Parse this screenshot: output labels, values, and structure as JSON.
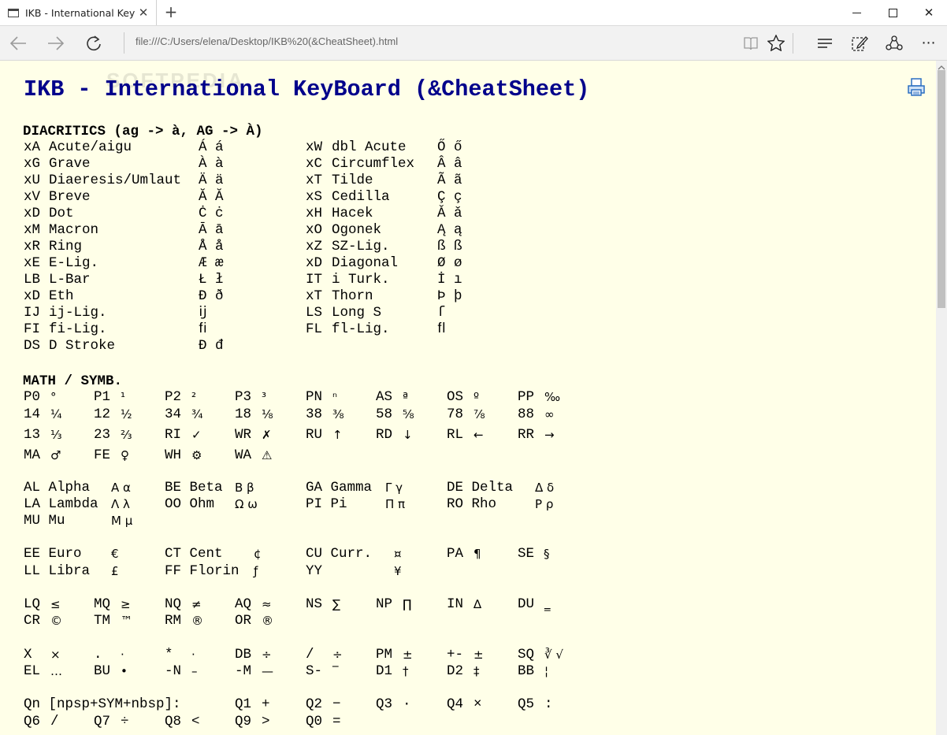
{
  "browser": {
    "tab_title": "IKB - International KeyBo",
    "address": "file:///C:/Users/elena/Desktop/IKB%20(&CheatSheet).html"
  },
  "watermark": "SOFTPEDIA",
  "page": {
    "title": "IKB - International KeyBoard (&CheatSheet)",
    "diacritics": {
      "heading": "DIACRITICS (ag -> à, AG -> À)",
      "left": [
        {
          "code": "xA",
          "name": "Acute/aigu",
          "chars": "Á á"
        },
        {
          "code": "xG",
          "name": "Grave",
          "chars": "À à"
        },
        {
          "code": "xU",
          "name": "Diaeresis/Umlaut",
          "chars": "Ä ä"
        },
        {
          "code": "xV",
          "name": "Breve",
          "chars": "Ă Ă"
        },
        {
          "code": "xD",
          "name": "Dot",
          "chars": "Ċ ċ"
        },
        {
          "code": "xM",
          "name": "Macron",
          "chars": "Ā ā"
        },
        {
          "code": "xR",
          "name": "Ring",
          "chars": "Å å"
        },
        {
          "code": "xE",
          "name": "E-Lig.",
          "chars": "Æ æ"
        },
        {
          "code": "LB",
          "name": "L-Bar",
          "chars": "Ł ł"
        },
        {
          "code": "xD",
          "name": "Eth",
          "chars": "Ð ð"
        },
        {
          "code": "IJ",
          "name": "ij-Lig.",
          "chars": "ĳ"
        },
        {
          "code": "FI",
          "name": "fi-Lig.",
          "chars": "ﬁ"
        },
        {
          "code": "DS",
          "name": "D Stroke",
          "chars": "Đ đ"
        }
      ],
      "right": [
        {
          "code": "xW",
          "name": "dbl Acute",
          "chars": "Ő ő"
        },
        {
          "code": "xC",
          "name": "Circumflex",
          "chars": "Â â"
        },
        {
          "code": "xT",
          "name": "Tilde",
          "chars": "Ã ã"
        },
        {
          "code": "xS",
          "name": "Cedilla",
          "chars": "Ç ç"
        },
        {
          "code": "xH",
          "name": "Hacek",
          "chars": "Ǎ ǎ"
        },
        {
          "code": "xO",
          "name": "Ogonek",
          "chars": "Ą ą"
        },
        {
          "code": "xZ",
          "name": "SZ-Lig.",
          "chars": "ß ß"
        },
        {
          "code": "xD",
          "name": "Diagonal",
          "chars": "Ø ø"
        },
        {
          "code": "IT",
          "name": "i Turk.",
          "chars": "İ ı"
        },
        {
          "code": "xT",
          "name": "Thorn",
          "chars": "Þ þ"
        },
        {
          "code": "LS",
          "name": "Long S",
          "chars": "ſ"
        },
        {
          "code": "FL",
          "name": "fl-Lig.",
          "chars": "ﬂ"
        }
      ]
    },
    "math": {
      "heading": "MATH / SYMB.",
      "rows": [
        [
          [
            "P0",
            "°"
          ],
          [
            "P1",
            "¹"
          ],
          [
            "P2",
            "²"
          ],
          [
            "P3",
            "³"
          ],
          [
            "PN",
            "ⁿ"
          ],
          [
            "AS",
            "ª"
          ],
          [
            "OS",
            "º"
          ],
          [
            "PP",
            "‰"
          ]
        ],
        [
          [
            "14",
            "¼"
          ],
          [
            "12",
            "½"
          ],
          [
            "34",
            "¾"
          ],
          [
            "18",
            "⅛"
          ],
          [
            "38",
            "⅜"
          ],
          [
            "58",
            "⅝"
          ],
          [
            "78",
            "⅞"
          ],
          [
            "88",
            "∞"
          ]
        ],
        [
          [
            "13",
            "⅓"
          ],
          [
            "23",
            "⅔"
          ],
          [
            "RI",
            "✓"
          ],
          [
            "WR",
            "✗"
          ],
          [
            "RU",
            "↑"
          ],
          [
            "RD",
            "↓"
          ],
          [
            "RL",
            "←"
          ],
          [
            "RR",
            "→"
          ]
        ],
        [
          [
            "MA",
            "♂"
          ],
          [
            "FE",
            "♀"
          ],
          [
            "WH",
            "⚙"
          ],
          [
            "WA",
            "⚠"
          ]
        ]
      ]
    },
    "greek": [
      [
        [
          "AL Alpha",
          "Α α"
        ],
        [
          "BE Beta",
          "Β β"
        ],
        [
          "GA Gamma",
          "Γ γ"
        ],
        [
          "DE Delta",
          "Δ δ"
        ]
      ],
      [
        [
          "LA Lambda",
          "Λ λ"
        ],
        [
          "OO Ohm",
          "Ω ω"
        ],
        [
          "PI Pi",
          "Π π"
        ],
        [
          "RO Rho",
          "Ρ ρ"
        ]
      ],
      [
        [
          "MU Mu",
          "Μ μ"
        ]
      ]
    ],
    "currency": [
      [
        [
          "EE Euro",
          "€"
        ],
        [
          "CT Cent",
          "¢"
        ],
        [
          "CU Curr.",
          "¤"
        ],
        [
          "PA",
          "¶"
        ],
        [
          "SE",
          "§"
        ]
      ],
      [
        [
          "LL Libra",
          "£"
        ],
        [
          "FF Florin",
          "ƒ"
        ],
        [
          "YY",
          "¥"
        ]
      ]
    ],
    "relations": [
      [
        [
          "LQ",
          "≤"
        ],
        [
          "MQ",
          "≥"
        ],
        [
          "NQ",
          "≠"
        ],
        [
          "AQ",
          "≈"
        ],
        [
          "NS",
          "∑"
        ],
        [
          "NP",
          "∏"
        ],
        [
          "IN",
          "∆"
        ],
        [
          "DU",
          "‗"
        ]
      ],
      [
        [
          "CR",
          "©"
        ],
        [
          "TM",
          "™"
        ],
        [
          "RM",
          "®"
        ],
        [
          "OR",
          "®"
        ]
      ]
    ],
    "operators": [
      [
        [
          "X",
          "×"
        ],
        [
          ".",
          "·"
        ],
        [
          "*",
          "·"
        ],
        [
          "DB",
          "÷"
        ],
        [
          "/",
          "÷"
        ],
        [
          "PM",
          "±"
        ],
        [
          "+-",
          "±"
        ],
        [
          "SQ",
          "∛ √"
        ]
      ],
      [
        [
          "EL",
          "…"
        ],
        [
          "BU",
          "•"
        ],
        [
          "-N",
          "–"
        ],
        [
          "-M",
          "—"
        ],
        [
          "S-",
          "‾"
        ],
        [
          "D1",
          "†"
        ],
        [
          "D2",
          "‡"
        ],
        [
          "BB",
          "¦"
        ]
      ]
    ],
    "quick": {
      "intro": "Qn [npsp+SYM+nbsp]:",
      "row1": [
        [
          "Q1",
          "+"
        ],
        [
          "Q2",
          "−"
        ],
        [
          "Q3",
          "·"
        ],
        [
          "Q4",
          "×"
        ],
        [
          "Q5",
          ":"
        ]
      ],
      "row2": [
        [
          "Q6",
          "/"
        ],
        [
          "Q7",
          "÷"
        ],
        [
          "Q8",
          "<"
        ],
        [
          "Q9",
          ">"
        ],
        [
          "Q0",
          "="
        ]
      ]
    }
  }
}
